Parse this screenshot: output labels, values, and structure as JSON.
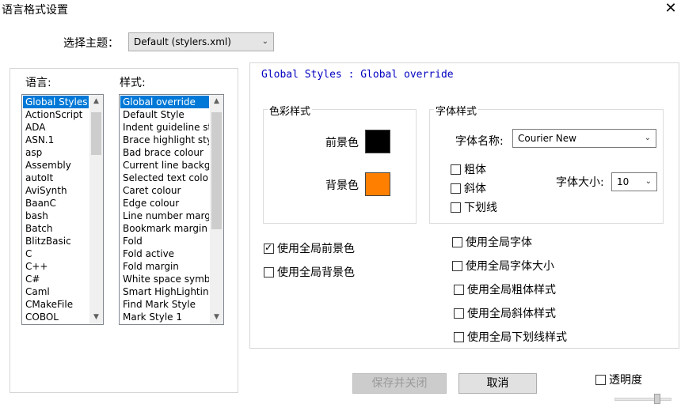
{
  "window": {
    "title": "语言格式设置",
    "close_glyph": "✕"
  },
  "theme": {
    "label": "选择主题：",
    "value": "Default (stylers.xml)"
  },
  "languages": {
    "header": "语言:",
    "items": [
      "Global Styles",
      "ActionScript",
      "ADA",
      "ASN.1",
      "asp",
      "Assembly",
      "autoIt",
      "AviSynth",
      "BaanC",
      "bash",
      "Batch",
      "BlitzBasic",
      "C",
      "C++",
      "C#",
      "Caml",
      "CMakeFile",
      "COBOL"
    ],
    "selected_index": 0
  },
  "styles": {
    "header": "样式:",
    "items": [
      "Global override",
      "Default Style",
      "Indent guideline st",
      "Brace highlight styl",
      "Bad brace colour",
      "Current line backgr",
      "Selected text colou",
      "Caret colour",
      "Edge colour",
      "Line number marg",
      "Bookmark margin",
      "Fold",
      "Fold active",
      "Fold margin",
      "White space symbo",
      "Smart HighLighting",
      "Find Mark Style",
      "Mark Style 1"
    ],
    "selected_index": 0
  },
  "style_title": "Global Styles : Global override",
  "color_group": {
    "legend": "色彩样式",
    "fg_label": "前景色",
    "fg_color": "#000000",
    "bg_label": "背景色",
    "bg_color": "#ff8000"
  },
  "font_group": {
    "legend": "字体样式",
    "name_label": "字体名称:",
    "name_value": "Courier New",
    "bold": "粗体",
    "italic": "斜体",
    "underline": "下划线",
    "size_label": "字体大小:",
    "size_value": "10"
  },
  "global_opts": {
    "fg": {
      "label": "使用全局前景色",
      "checked": true
    },
    "bg": {
      "label": "使用全局背景色",
      "checked": false
    },
    "font": {
      "label": "使用全局字体",
      "checked": false
    },
    "font_size": {
      "label": "使用全局字体大小",
      "checked": false
    },
    "bold": {
      "label": "使用全局粗体样式",
      "checked": false
    },
    "italic": {
      "label": "使用全局斜体样式",
      "checked": false
    },
    "underline": {
      "label": "使用全局下划线样式",
      "checked": false
    }
  },
  "buttons": {
    "save_close": "保存并关闭",
    "cancel": "取消"
  },
  "transparency": {
    "label": "透明度",
    "checked": false
  }
}
